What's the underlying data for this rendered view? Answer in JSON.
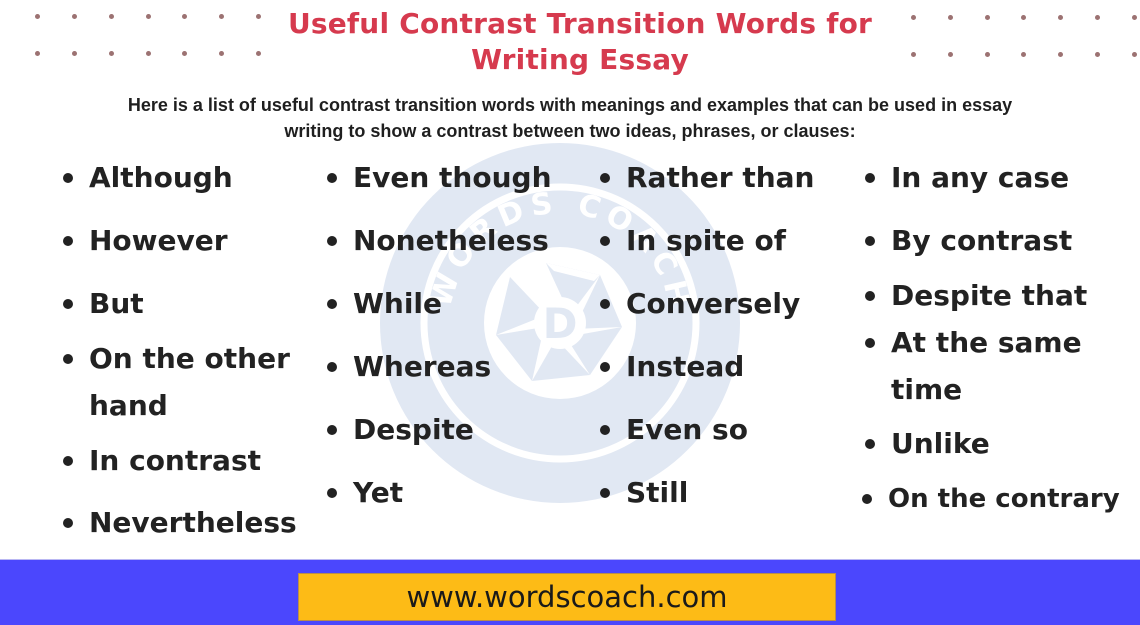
{
  "header": {
    "title_line1": "Useful Contrast Transition Words for",
    "title_line2": "Writing Essay",
    "intro_line1": "Here is a list of useful contrast transition words with meanings and examples that can be used in essay",
    "intro_line2": "writing to show a contrast between two ideas, phrases, or clauses:"
  },
  "watermark": {
    "text": "WORDS COACH",
    "letter": "D"
  },
  "columns": [
    {
      "items": [
        {
          "label": "Although"
        },
        {
          "label": "However"
        },
        {
          "label": "But"
        },
        {
          "label": "On the other",
          "label2": "hand"
        },
        {
          "label": "In contrast"
        },
        {
          "label": "Nevertheless"
        }
      ]
    },
    {
      "items": [
        {
          "label": "Even though"
        },
        {
          "label": "Nonetheless"
        },
        {
          "label": "While"
        },
        {
          "label": "Whereas"
        },
        {
          "label": "Despite"
        },
        {
          "label": "Yet"
        }
      ]
    },
    {
      "items": [
        {
          "label": "Rather than"
        },
        {
          "label": "In spite of"
        },
        {
          "label": "Conversely"
        },
        {
          "label": "Instead"
        },
        {
          "label": "Even so"
        },
        {
          "label": "Still"
        }
      ]
    },
    {
      "items": [
        {
          "label": "In any case"
        },
        {
          "label": "By contrast"
        },
        {
          "label": "Despite that"
        },
        {
          "label": "At the same",
          "label2": "time"
        },
        {
          "label": "Unlike"
        },
        {
          "label": "On the contrary"
        }
      ]
    }
  ],
  "footer": {
    "url": "www.wordscoach.com"
  },
  "colors": {
    "title": "#d63a4e",
    "text": "#222222",
    "band": "#4b47fd",
    "url_box": "#fdbb16",
    "watermark": "#e1e8f3",
    "dots": "#9c7272"
  }
}
